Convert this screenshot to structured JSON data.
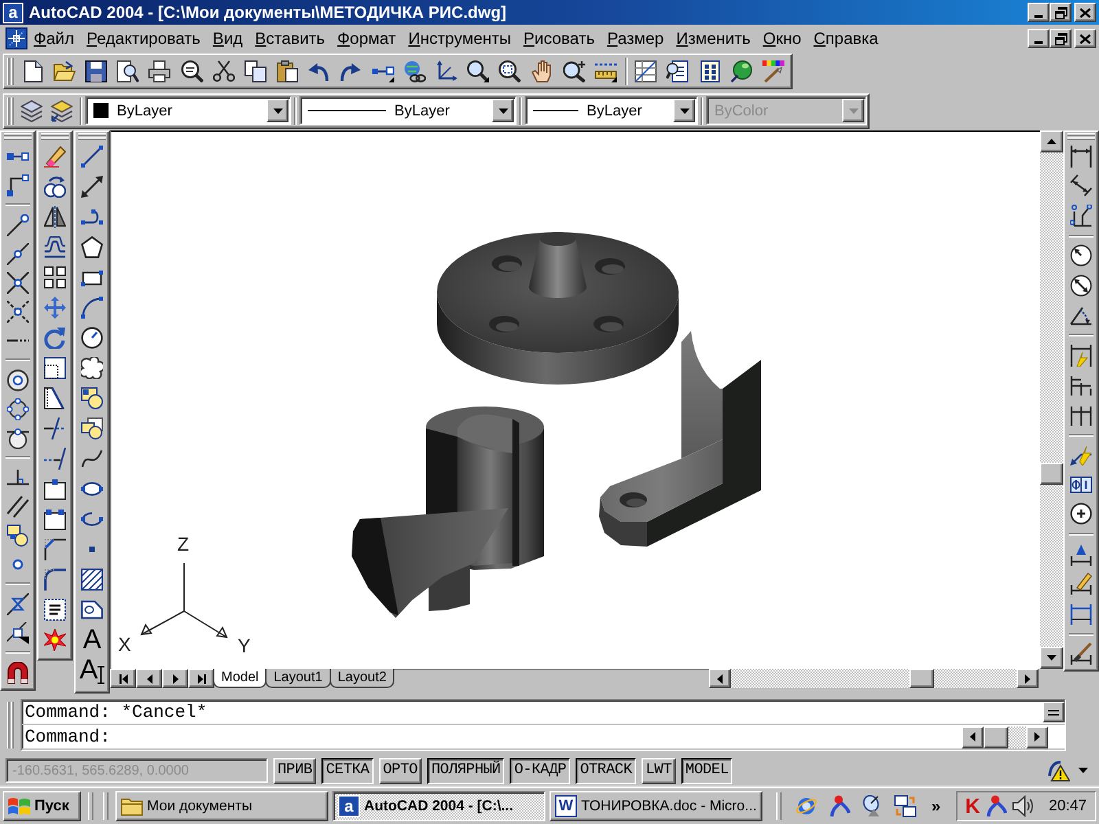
{
  "window": {
    "logo": "a",
    "title": "AutoCAD 2004 - [C:\\Мои документы\\МЕТОДИЧКА РИС.dwg]"
  },
  "menu": [
    "Файл",
    "Редактировать",
    "Вид",
    "Вставить",
    "Формат",
    "Инструменты",
    "Рисовать",
    "Размер",
    "Изменить",
    "Окно",
    "Справка"
  ],
  "properties_toolbar": {
    "color_setting": "ByLayer",
    "linetype": "ByLayer",
    "lineweight": "ByLayer",
    "plot_style": {
      "value": "ByColor",
      "disabled": true
    }
  },
  "draw_toolbar": {
    "mtext_glyph": "A",
    "text_glyph": "A"
  },
  "drawing": {
    "ucs_labels": {
      "z": "Z",
      "x": "X",
      "y": "Y"
    }
  },
  "layout_tabs": [
    {
      "label": "Model",
      "selected": true
    },
    {
      "label": "Layout1",
      "selected": false
    },
    {
      "label": "Layout2",
      "selected": false
    }
  ],
  "command_lines": [
    "Command: *Cancel*",
    "Command:"
  ],
  "status_bar": {
    "coordinates": {
      "value": "-160.5631, 565.6289, 0.0000",
      "disabled": true
    },
    "buttons": [
      {
        "label": "ПРИВ",
        "on": false
      },
      {
        "label": "СЕТКА",
        "on": true
      },
      {
        "label": "ОРТО",
        "on": false
      },
      {
        "label": "ПОЛЯРНЫЙ",
        "on": true
      },
      {
        "label": "О-КАДР",
        "on": true
      },
      {
        "label": "OTRACK",
        "on": true
      },
      {
        "label": "LWT",
        "on": false
      },
      {
        "label": "MODEL",
        "on": true
      }
    ]
  },
  "taskbar": {
    "start": "Пуск",
    "windows": [
      {
        "label": "Мои документы",
        "kind": "folder",
        "selected": false
      },
      {
        "label": "AutoCAD 2004 - [C:\\...",
        "kind": "autocad",
        "logo": "a",
        "selected": true
      },
      {
        "label": "ТОНИРОВКА.doc - Micro...",
        "kind": "word",
        "logo": "W",
        "selected": false
      }
    ],
    "overflow": "»",
    "tray_logo": "K",
    "clock": "20:47"
  }
}
